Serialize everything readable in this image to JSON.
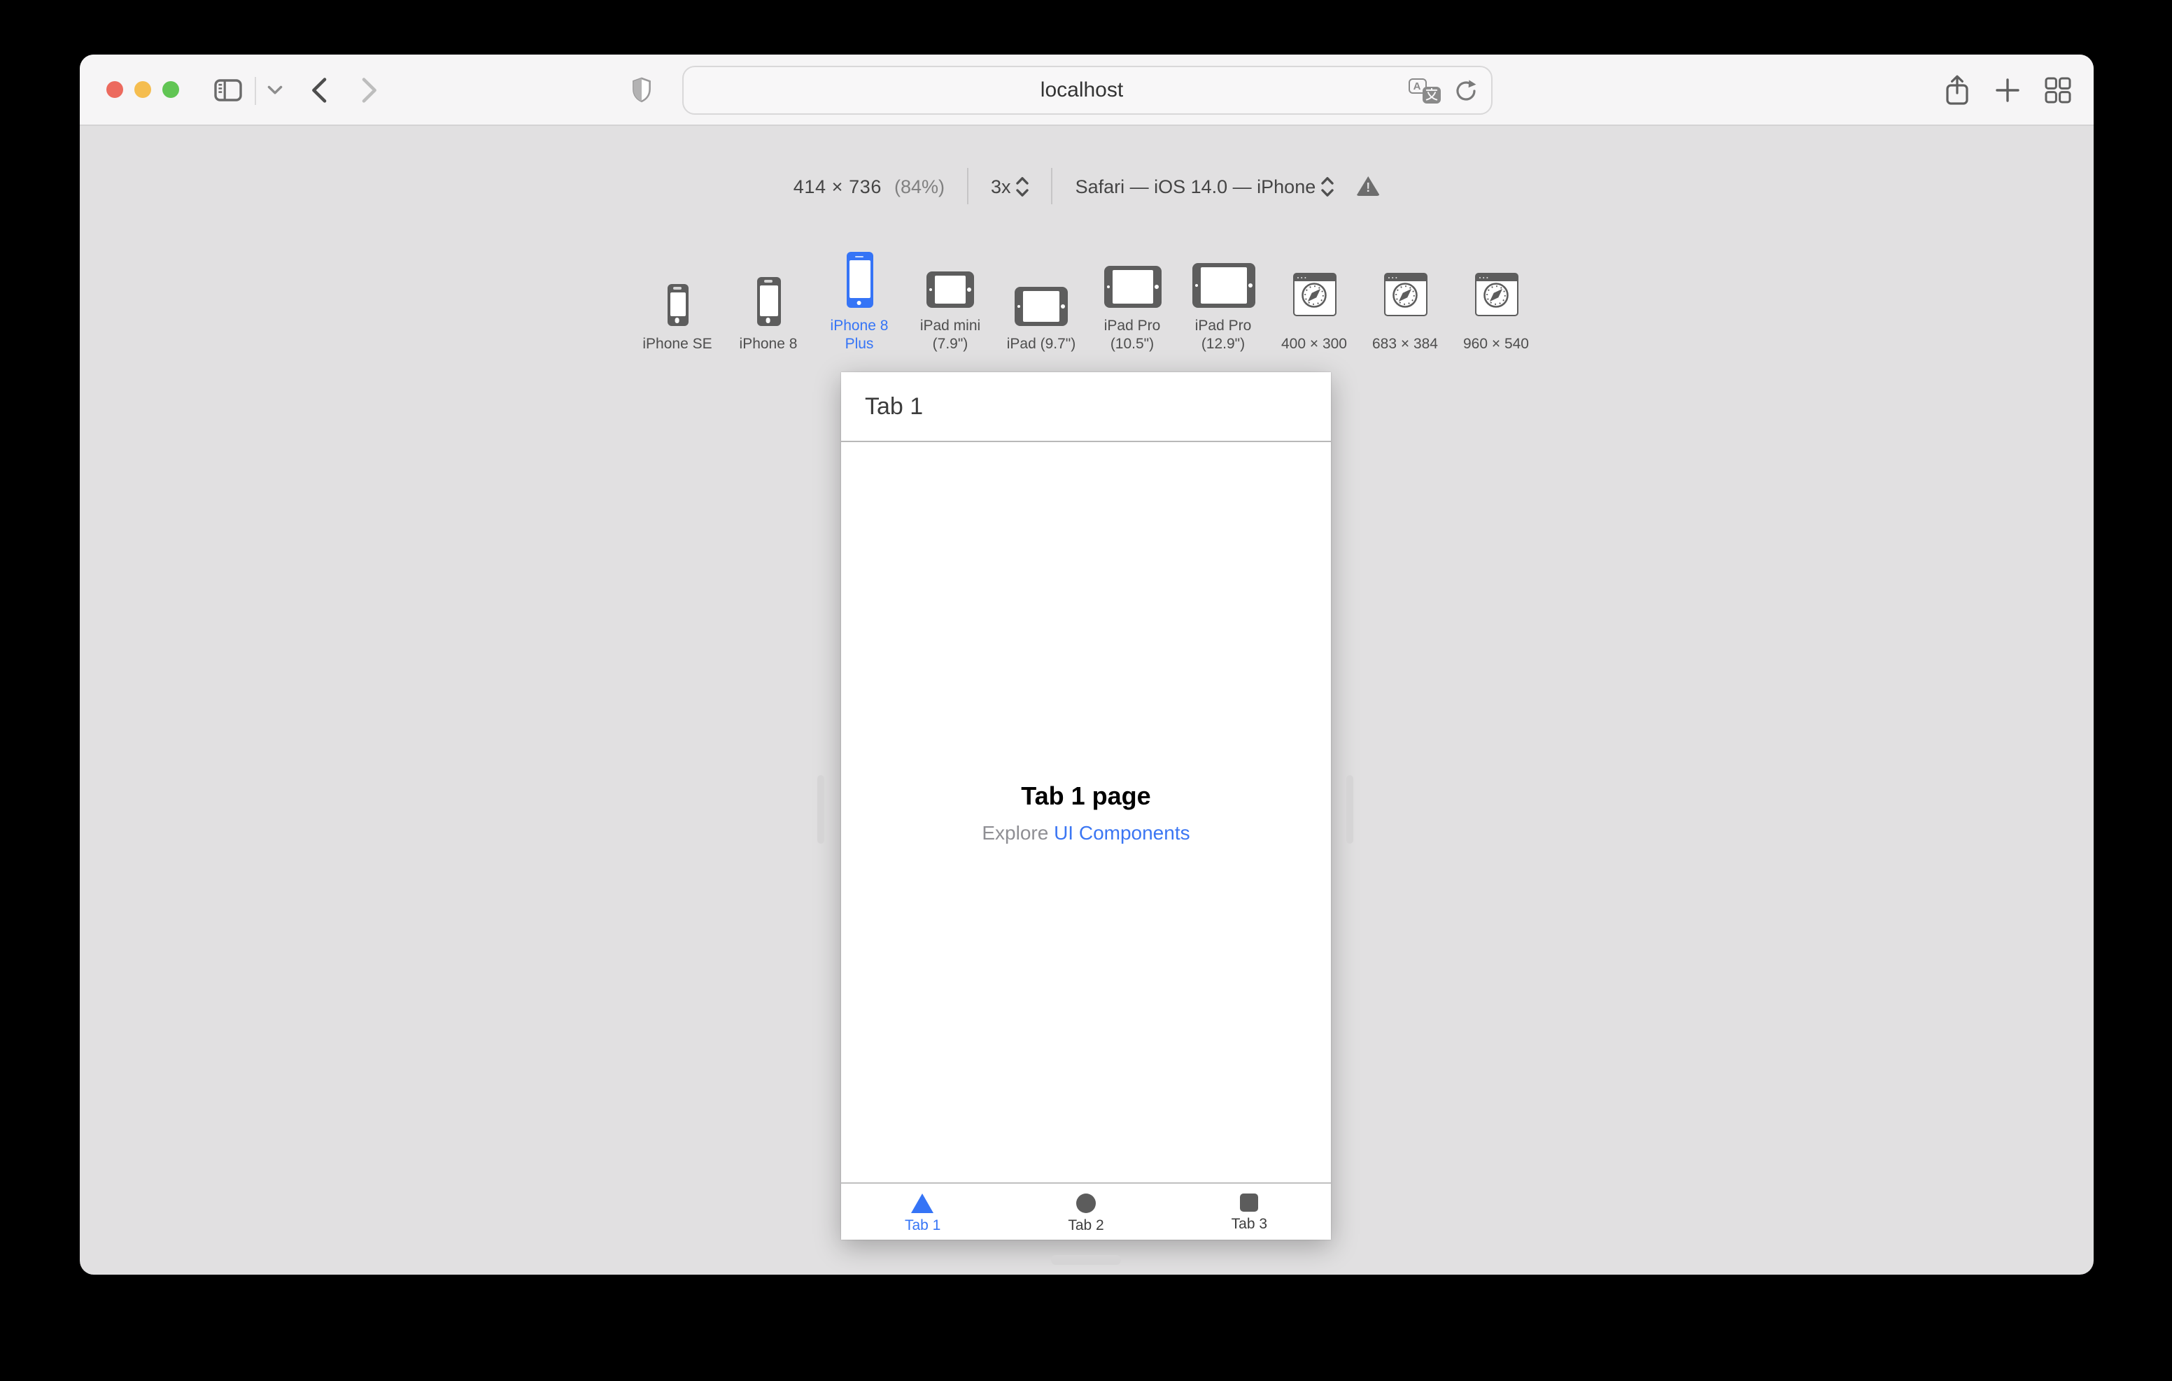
{
  "colors": {
    "accent_blue": "#3574f6",
    "traffic_red": "#ec6a5e",
    "traffic_yellow": "#f5bd4f",
    "traffic_green": "#61c554",
    "window_bg": "#e1e0e1",
    "toolbar_bg": "#f6f5f6"
  },
  "toolbar": {
    "url": "localhost"
  },
  "controls": {
    "dimensions": "414 × 736",
    "zoom_percent": "(84%)",
    "pixel_ratio": "3x",
    "user_agent": "Safari — iOS 14.0 — iPhone",
    "warning_mark": "!"
  },
  "devices": {
    "items": [
      {
        "label": "iPhone SE",
        "type": "iphone",
        "selected": false
      },
      {
        "label": "iPhone 8",
        "type": "iphone",
        "selected": false
      },
      {
        "label": "iPhone 8 Plus",
        "type": "iphone",
        "selected": true
      },
      {
        "label": "iPad mini (7.9\")",
        "type": "ipad",
        "selected": false
      },
      {
        "label": "iPad (9.7\")",
        "type": "ipad",
        "selected": false
      },
      {
        "label": "iPad Pro (10.5\")",
        "type": "ipad",
        "selected": false
      },
      {
        "label": "iPad Pro (12.9\")",
        "type": "ipad",
        "selected": false
      },
      {
        "label": "400 × 300",
        "type": "browser-window",
        "selected": false
      },
      {
        "label": "683 × 384",
        "type": "browser-window",
        "selected": false
      },
      {
        "label": "960 × 540",
        "type": "browser-window",
        "selected": false
      }
    ]
  },
  "viewport": {
    "nav_title": "Tab 1",
    "page_title": "Tab 1 page",
    "subtitle_prefix": "Explore",
    "subtitle_link": "UI Components",
    "tabs": [
      {
        "label": "Tab 1",
        "shape": "triangle",
        "active": true
      },
      {
        "label": "Tab 2",
        "shape": "circle",
        "active": false
      },
      {
        "label": "Tab 3",
        "shape": "square",
        "active": false
      }
    ]
  },
  "icons": [
    "sidebar-toggle-icon",
    "chevron-down-icon",
    "back-icon",
    "forward-icon",
    "privacy-shield-icon",
    "translate-icon",
    "reload-icon",
    "share-icon",
    "new-tab-icon",
    "tab-overview-icon",
    "stepper-icon",
    "warning-icon",
    "compass-icon",
    "triangle-icon",
    "circle-icon",
    "square-icon"
  ]
}
